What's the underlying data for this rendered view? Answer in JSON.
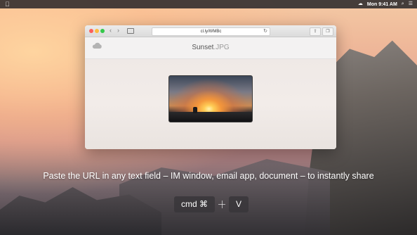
{
  "menubar": {
    "clock": "Mon 9:41 AM",
    "icons": [
      "apple-icon",
      "cloud-icon",
      "search-icon",
      "list-icon"
    ]
  },
  "browser": {
    "url": "cl.ly/WMBc",
    "app_title": "Sunset",
    "app_title_ext": ".JPG"
  },
  "caption": "Paste the URL in any text field – IM window, email app, document – to instantly share",
  "shortcut": {
    "key1": "cmd ⌘",
    "key2": "V"
  }
}
